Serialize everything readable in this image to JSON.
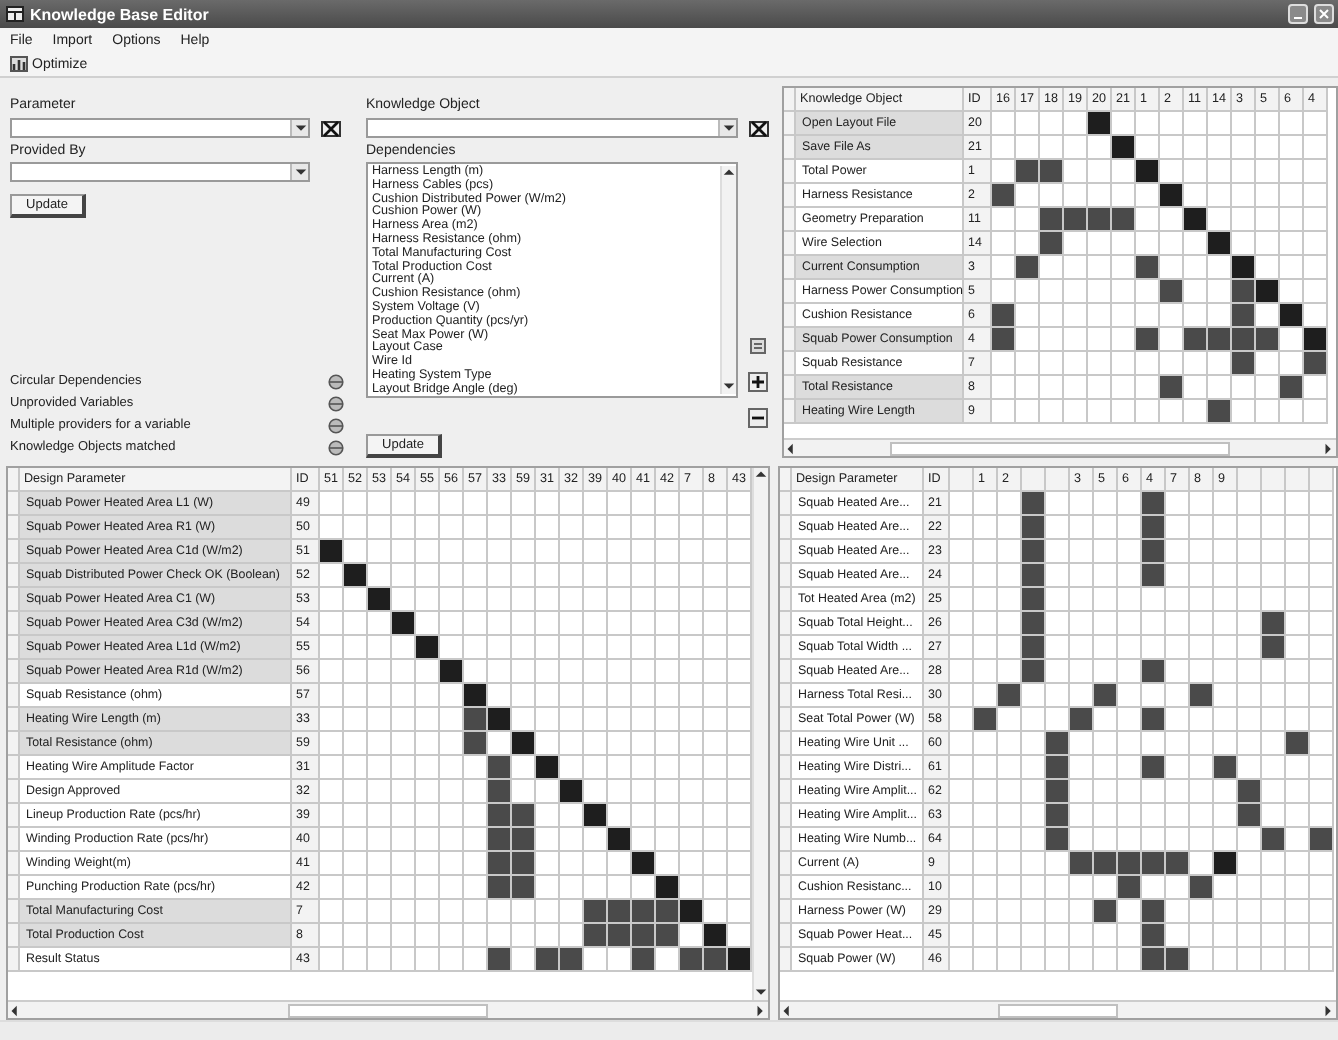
{
  "window": {
    "title": "Knowledge Base Editor"
  },
  "menu": [
    "File",
    "Import",
    "Options",
    "Help"
  ],
  "toolbar": [
    {
      "label": "Optimize"
    }
  ],
  "parameter": {
    "label": "Parameter"
  },
  "provided_by": {
    "label": "Provided By"
  },
  "update_left": "Update",
  "checks": [
    "Circular Dependencies",
    "Unprovided Variables",
    "Multiple providers for a variable",
    "Knowledge Objects matched"
  ],
  "knowledge_object": {
    "label": "Knowledge Object"
  },
  "dependencies": {
    "label": "Dependencies",
    "items": [
      "Harness Length (m)",
      "Harness Cables (pcs)",
      "Cushion Distributed Power (W/m2)",
      "Cushion Power (W)",
      "Harness Area (m2)",
      "Harness Resistance (ohm)",
      "Total Manufacturing Cost",
      "Total Production Cost",
      "Current (A)",
      "Cushion Resistance (ohm)",
      "System Voltage (V)",
      "Production Quantity (pcs/yr)",
      "Seat Max Power (W)",
      "Layout Case",
      "Wire Id",
      "Heating System Type",
      "Layout Bridge Angle (deg)"
    ]
  },
  "update_right": "Update",
  "object_matrix": {
    "name_header": "Knowledge Object",
    "id_header": "ID",
    "columns": [
      {
        "label": "16"
      },
      {
        "label": "17"
      },
      {
        "label": "18"
      },
      {
        "label": "19"
      },
      {
        "label": "20"
      },
      {
        "label": "21"
      },
      {
        "label": "1"
      },
      {
        "label": "2"
      },
      {
        "label": "11"
      },
      {
        "label": "14"
      },
      {
        "label": "3"
      },
      {
        "label": "5"
      },
      {
        "label": "6"
      },
      {
        "label": "4"
      }
    ],
    "rows": [
      {
        "name": "Open Layout File",
        "id": "20",
        "highlighted": true
      },
      {
        "name": "Save File As",
        "id": "21",
        "highlighted": true
      },
      {
        "name": "Total Power",
        "id": "1",
        "highlighted": false,
        "depends": [
          false,
          true,
          true,
          false,
          false,
          false,
          false,
          false,
          false,
          false,
          false,
          false,
          false,
          false
        ]
      },
      {
        "name": "Harness Resistance",
        "id": "2",
        "highlighted": false,
        "depends": [
          true,
          false,
          false,
          false,
          false,
          false,
          false,
          false,
          false,
          false,
          false,
          false,
          false,
          false
        ]
      },
      {
        "name": "Geometry Preparation",
        "id": "11",
        "highlighted": false,
        "depends": [
          false,
          false,
          true,
          true,
          true,
          true,
          false,
          false,
          false,
          false,
          false,
          false,
          false,
          false
        ]
      },
      {
        "name": "Wire Selection",
        "id": "14",
        "highlighted": false,
        "depends": [
          false,
          false,
          true,
          false,
          false,
          false,
          false,
          false,
          false,
          false,
          false,
          false,
          false,
          false
        ]
      },
      {
        "name": "Current Consumption",
        "id": "3",
        "highlighted": true,
        "depends": [
          false,
          true,
          false,
          false,
          false,
          false,
          true,
          false,
          false,
          false,
          false,
          false,
          false,
          false
        ]
      },
      {
        "name": "Harness Power Consumption",
        "id": "5",
        "highlighted": false,
        "depends": [
          false,
          false,
          false,
          false,
          false,
          false,
          false,
          true,
          false,
          false,
          true,
          false,
          false,
          false
        ]
      },
      {
        "name": "Cushion Resistance",
        "id": "6",
        "highlighted": false,
        "depends": [
          true,
          false,
          false,
          false,
          false,
          false,
          false,
          false,
          false,
          false,
          true,
          false,
          false,
          false
        ]
      },
      {
        "name": "Squab Power Consumption",
        "id": "4",
        "highlighted": true,
        "depends": [
          true,
          false,
          false,
          false,
          false,
          false,
          true,
          false,
          true,
          true,
          true,
          true,
          false,
          false
        ]
      },
      {
        "name": "Squab Resistance",
        "id": "7",
        "highlighted": false,
        "depends": [
          false,
          false,
          false,
          false,
          false,
          false,
          false,
          false,
          false,
          false,
          true,
          false,
          false,
          true
        ]
      },
      {
        "name": "Total Resistance",
        "id": "8",
        "highlighted": true,
        "depends": [
          false,
          false,
          false,
          false,
          false,
          false,
          false,
          true,
          false,
          false,
          false,
          false,
          true,
          false
        ]
      },
      {
        "name": "Heating Wire Length",
        "id": "9",
        "highlighted": true,
        "depends": [
          false,
          false,
          false,
          false,
          false,
          false,
          false,
          false,
          false,
          true,
          false,
          false,
          false,
          false
        ]
      }
    ]
  },
  "parameter_matrix": {
    "name_header": "Design Parameter",
    "id_header": "ID",
    "columns": [
      {
        "label": "51"
      },
      {
        "label": "52"
      },
      {
        "label": "53"
      },
      {
        "label": "54"
      },
      {
        "label": "55"
      },
      {
        "label": "56"
      },
      {
        "label": "57"
      },
      {
        "label": "33"
      },
      {
        "label": "59"
      },
      {
        "label": "31"
      },
      {
        "label": "32"
      },
      {
        "label": "39"
      },
      {
        "label": "40"
      },
      {
        "label": "41"
      },
      {
        "label": "42"
      },
      {
        "label": "7"
      },
      {
        "label": "8"
      },
      {
        "label": "43"
      }
    ],
    "rows": [
      {
        "name": "Squab Power Heated Area L1 (W)",
        "id": "49",
        "highlighted": true
      },
      {
        "name": "Squab Power Heated Area R1 (W)",
        "id": "50",
        "highlighted": true
      },
      {
        "name": "Squab Power Heated Area C1d (W/m2)",
        "id": "51",
        "highlighted": true
      },
      {
        "name": "Squab Distributed Power Check OK (Boolean)",
        "id": "52",
        "highlighted": true
      },
      {
        "name": "Squab Power Heated Area C1 (W)",
        "id": "53",
        "highlighted": true
      },
      {
        "name": "Squab Power Heated Area C3d (W/m2)",
        "id": "54",
        "highlighted": true
      },
      {
        "name": "Squab Power Heated Area L1d (W/m2)",
        "id": "55",
        "highlighted": true
      },
      {
        "name": "Squab Power Heated Area R1d (W/m2)",
        "id": "56",
        "highlighted": true
      },
      {
        "name": "Squab Resistance (ohm)",
        "id": "57",
        "highlighted": false
      },
      {
        "name": "Heating Wire Length (m)",
        "id": "33",
        "highlighted": true,
        "depends": [
          false,
          false,
          false,
          false,
          false,
          false,
          true,
          false,
          false,
          false,
          false,
          false,
          false,
          false,
          false,
          false,
          false,
          false
        ]
      },
      {
        "name": "Total Resistance (ohm)",
        "id": "59",
        "highlighted": true,
        "depends": [
          false,
          false,
          false,
          false,
          false,
          false,
          true,
          false,
          false,
          false,
          false,
          false,
          false,
          false,
          false,
          false,
          false,
          false
        ]
      },
      {
        "name": "Heating Wire Amplitude Factor",
        "id": "31",
        "highlighted": false,
        "depends": [
          false,
          false,
          false,
          false,
          false,
          false,
          false,
          true,
          false,
          false,
          false,
          false,
          false,
          false,
          false,
          false,
          false,
          false
        ]
      },
      {
        "name": "Design Approved",
        "id": "32",
        "highlighted": false,
        "depends": [
          false,
          false,
          false,
          false,
          false,
          false,
          false,
          true,
          false,
          false,
          false,
          false,
          false,
          false,
          false,
          false,
          false,
          false
        ]
      },
      {
        "name": "Lineup Production Rate (pcs/hr)",
        "id": "39",
        "highlighted": false,
        "depends": [
          false,
          false,
          false,
          false,
          false,
          false,
          false,
          true,
          true,
          false,
          false,
          false,
          false,
          false,
          false,
          false,
          false,
          false
        ]
      },
      {
        "name": "Winding Production Rate (pcs/hr)",
        "id": "40",
        "highlighted": false,
        "depends": [
          false,
          false,
          false,
          false,
          false,
          false,
          false,
          true,
          true,
          false,
          false,
          false,
          false,
          false,
          false,
          false,
          false,
          false
        ]
      },
      {
        "name": "Winding Weight(m)",
        "id": "41",
        "highlighted": false,
        "depends": [
          false,
          false,
          false,
          false,
          false,
          false,
          false,
          true,
          true,
          false,
          false,
          false,
          false,
          false,
          false,
          false,
          false,
          false
        ]
      },
      {
        "name": "Punching Production Rate (pcs/hr)",
        "id": "42",
        "highlighted": false,
        "depends": [
          false,
          false,
          false,
          false,
          false,
          false,
          false,
          true,
          true,
          false,
          false,
          false,
          false,
          false,
          false,
          false,
          false,
          false
        ]
      },
      {
        "name": "Total Manufacturing Cost",
        "id": "7",
        "highlighted": true,
        "depends": [
          false,
          false,
          false,
          false,
          false,
          false,
          false,
          false,
          false,
          false,
          false,
          true,
          true,
          true,
          true,
          false,
          false,
          false
        ]
      },
      {
        "name": "Total Production Cost",
        "id": "8",
        "highlighted": true,
        "depends": [
          false,
          false,
          false,
          false,
          false,
          false,
          false,
          false,
          false,
          false,
          false,
          true,
          true,
          true,
          true,
          false,
          false,
          false
        ]
      },
      {
        "name": "Result Status",
        "id": "43",
        "highlighted": false,
        "depends": [
          false,
          false,
          false,
          false,
          false,
          false,
          false,
          true,
          false,
          true,
          true,
          false,
          false,
          true,
          false,
          true,
          true,
          false
        ]
      }
    ]
  },
  "variable_matrix": {
    "name_header": "Design Parameter",
    "id_header": "ID",
    "columns": [
      {},
      {
        "label": "1"
      },
      {
        "label": "2"
      },
      {},
      {},
      {
        "label": "3"
      },
      {
        "label": "5"
      },
      {
        "label": "6"
      },
      {
        "label": "4"
      },
      {
        "label": "7"
      },
      {
        "label": "8"
      },
      {
        "label": "9"
      },
      {},
      {},
      {},
      {}
    ],
    "rows": [
      {
        "name": "Squab Heated Are...",
        "id": "21",
        "highlighted": false,
        "depends": [
          false,
          false,
          false,
          true,
          false,
          false,
          false,
          false,
          true,
          false,
          false,
          false,
          false,
          false,
          false,
          false
        ]
      },
      {
        "name": "Squab Heated Are...",
        "id": "22",
        "highlighted": false,
        "depends": [
          false,
          false,
          false,
          true,
          false,
          false,
          false,
          false,
          true,
          false,
          false,
          false,
          false,
          false,
          false,
          false
        ]
      },
      {
        "name": "Squab Heated Are...",
        "id": "23",
        "highlighted": false,
        "depends": [
          false,
          false,
          false,
          true,
          false,
          false,
          false,
          false,
          true,
          false,
          false,
          false,
          false,
          false,
          false,
          false
        ]
      },
      {
        "name": "Squab Heated Are...",
        "id": "24",
        "highlighted": false,
        "depends": [
          false,
          false,
          false,
          true,
          false,
          false,
          false,
          false,
          true,
          false,
          false,
          false,
          false,
          false,
          false,
          false
        ]
      },
      {
        "name": "Tot Heated Area (m2)",
        "id": "25",
        "highlighted": false,
        "depends": [
          false,
          false,
          false,
          true,
          false,
          false,
          false,
          false,
          false,
          false,
          false,
          false,
          false,
          false,
          false,
          false
        ]
      },
      {
        "name": "Squab Total Height...",
        "id": "26",
        "highlighted": false,
        "depends": [
          false,
          false,
          false,
          true,
          false,
          false,
          false,
          false,
          false,
          false,
          false,
          false,
          false,
          true,
          false,
          false
        ]
      },
      {
        "name": "Squab Total Width ...",
        "id": "27",
        "highlighted": false,
        "depends": [
          false,
          false,
          false,
          true,
          false,
          false,
          false,
          false,
          false,
          false,
          false,
          false,
          false,
          true,
          false,
          false
        ]
      },
      {
        "name": "Squab Heated Are...",
        "id": "28",
        "highlighted": false,
        "depends": [
          false,
          false,
          false,
          true,
          false,
          false,
          false,
          false,
          true,
          false,
          false,
          false,
          false,
          false,
          false,
          false
        ]
      },
      {
        "name": "Harness Total Resi...",
        "id": "30",
        "highlighted": false,
        "depends": [
          false,
          false,
          true,
          false,
          false,
          false,
          true,
          false,
          false,
          false,
          true,
          false,
          false,
          false,
          false,
          false
        ]
      },
      {
        "name": "Seat Total Power (W)",
        "id": "58",
        "highlighted": false,
        "depends": [
          false,
          true,
          false,
          false,
          false,
          true,
          false,
          false,
          true,
          false,
          false,
          false,
          false,
          false,
          false,
          false
        ]
      },
      {
        "name": "Heating Wire Unit ...",
        "id": "60",
        "highlighted": false,
        "depends": [
          false,
          false,
          false,
          false,
          true,
          false,
          false,
          false,
          false,
          false,
          false,
          false,
          false,
          false,
          true,
          false
        ]
      },
      {
        "name": "Heating Wire Distri...",
        "id": "61",
        "highlighted": false,
        "depends": [
          false,
          false,
          false,
          false,
          true,
          false,
          false,
          false,
          true,
          false,
          false,
          true,
          false,
          false,
          false,
          false
        ]
      },
      {
        "name": "Heating Wire Amplit...",
        "id": "62",
        "highlighted": false,
        "depends": [
          false,
          false,
          false,
          false,
          true,
          false,
          false,
          false,
          false,
          false,
          false,
          false,
          true,
          false,
          false,
          false
        ]
      },
      {
        "name": "Heating Wire Amplit...",
        "id": "63",
        "highlighted": false,
        "depends": [
          false,
          false,
          false,
          false,
          true,
          false,
          false,
          false,
          false,
          false,
          false,
          false,
          true,
          false,
          false,
          false
        ]
      },
      {
        "name": "Heating Wire Numb...",
        "id": "64",
        "highlighted": false,
        "depends": [
          false,
          false,
          false,
          false,
          true,
          false,
          false,
          false,
          false,
          false,
          false,
          false,
          false,
          true,
          false,
          true
        ]
      },
      {
        "name": "Current (A)",
        "id": "9",
        "highlighted": false,
        "depends": [
          false,
          false,
          false,
          false,
          false,
          true,
          true,
          true,
          true,
          true,
          false,
          false,
          false,
          false,
          false,
          false
        ]
      },
      {
        "name": "Cushion Resistanc...",
        "id": "10",
        "highlighted": false,
        "depends": [
          false,
          false,
          false,
          false,
          false,
          false,
          false,
          true,
          false,
          false,
          true,
          false,
          false,
          false,
          false,
          false
        ]
      },
      {
        "name": "Harness Power (W)",
        "id": "29",
        "highlighted": false,
        "depends": [
          false,
          false,
          false,
          false,
          false,
          false,
          true,
          false,
          true,
          false,
          false,
          false,
          false,
          false,
          false,
          false
        ]
      },
      {
        "name": "Squab Power Heat...",
        "id": "45",
        "highlighted": false,
        "depends": [
          false,
          false,
          false,
          false,
          false,
          false,
          false,
          false,
          true,
          false,
          false,
          false,
          false,
          false,
          false,
          false
        ]
      },
      {
        "name": "Squab Power (W)",
        "id": "46",
        "highlighted": false,
        "depends": [
          false,
          false,
          false,
          false,
          false,
          false,
          false,
          false,
          true,
          true,
          false,
          false,
          false,
          false,
          false,
          false
        ]
      }
    ]
  }
}
